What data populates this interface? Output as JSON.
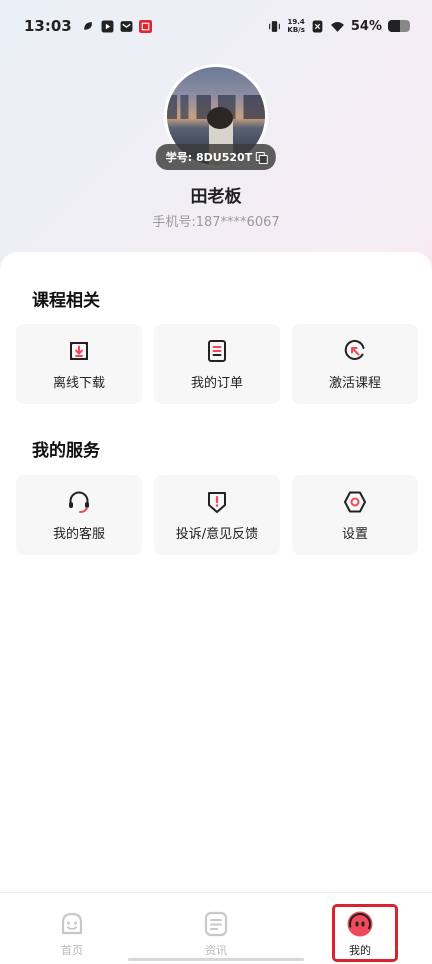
{
  "status_bar": {
    "time": "13:03",
    "network_speed": "19.4",
    "network_speed_unit": "KB/s",
    "battery": "54%"
  },
  "profile": {
    "student_id": "学号: 8DU520T",
    "name": "田老板",
    "phone": "手机号:187****6067"
  },
  "sections": {
    "course": {
      "title": "课程相关",
      "items": [
        {
          "label": "离线下载",
          "icon": "download-icon"
        },
        {
          "label": "我的订单",
          "icon": "order-icon"
        },
        {
          "label": "激活课程",
          "icon": "activate-icon"
        }
      ]
    },
    "service": {
      "title": "我的服务",
      "items": [
        {
          "label": "我的客服",
          "icon": "headset-icon"
        },
        {
          "label": "投诉/意见反馈",
          "icon": "feedback-icon"
        },
        {
          "label": "设置",
          "icon": "settings-icon"
        }
      ]
    }
  },
  "bottom_nav": {
    "items": [
      {
        "label": "首页",
        "icon": "home-icon"
      },
      {
        "label": "资讯",
        "icon": "news-icon"
      },
      {
        "label": "我的",
        "icon": "profile-icon"
      }
    ],
    "active": "我的"
  },
  "colors": {
    "accent": "#ef4a5c",
    "highlight": "#f6a9b7",
    "outline": "#d9232d"
  }
}
